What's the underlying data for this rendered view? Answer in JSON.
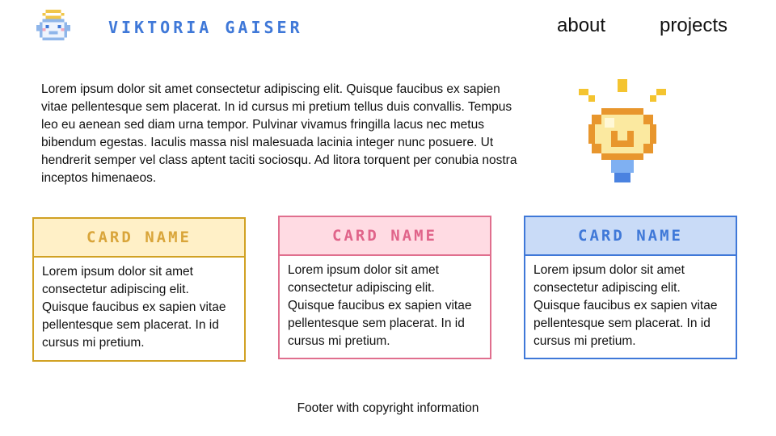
{
  "header": {
    "site_title": "VIKTORIA GAISER",
    "nav": [
      {
        "label": "about"
      },
      {
        "label": "projects"
      }
    ],
    "logo_icon": "angel-face-pixel-icon"
  },
  "intro": {
    "text": "Lorem ipsum dolor sit amet consectetur adipiscing elit. Quisque faucibus ex sapien vitae pellentesque sem placerat. In id cursus mi pretium tellus duis convallis. Tempus leo eu aenean sed diam urna tempor. Pulvinar vivamus fringilla lacus nec metus bibendum egestas. Iaculis massa nisl malesuada lacinia integer nunc posuere. Ut hendrerit semper vel class aptent taciti sociosqu. Ad litora torquent per conubia nostra inceptos himenaeos.",
    "illustration_icon": "lightbulb-pixel-icon"
  },
  "cards": [
    {
      "title": "CARD NAME",
      "body": "Lorem ipsum dolor sit amet consectetur adipiscing elit. Quisque faucibus ex sapien vitae pellentesque sem placerat. In id cursus mi pretium.",
      "accent": "#d1a123",
      "fill": "#fff0c7"
    },
    {
      "title": "CARD NAME",
      "body": "Lorem ipsum dolor sit amet consectetur adipiscing elit. Quisque faucibus ex sapien vitae pellentesque sem placerat. In id cursus mi pretium.",
      "accent": "#e06f8e",
      "fill": "#ffdbe3"
    },
    {
      "title": "CARD NAME",
      "body": "Lorem ipsum dolor sit amet consectetur adipiscing elit. Quisque faucibus ex sapien vitae pellentesque sem placerat. In id cursus mi pretium.",
      "accent": "#3f78d8",
      "fill": "#c9dbf7"
    }
  ],
  "footer": {
    "text": "Footer with copyright information"
  },
  "colors": {
    "brand_blue": "#3f78d8",
    "yellow": "#d1a123",
    "pink": "#e06f8e"
  }
}
